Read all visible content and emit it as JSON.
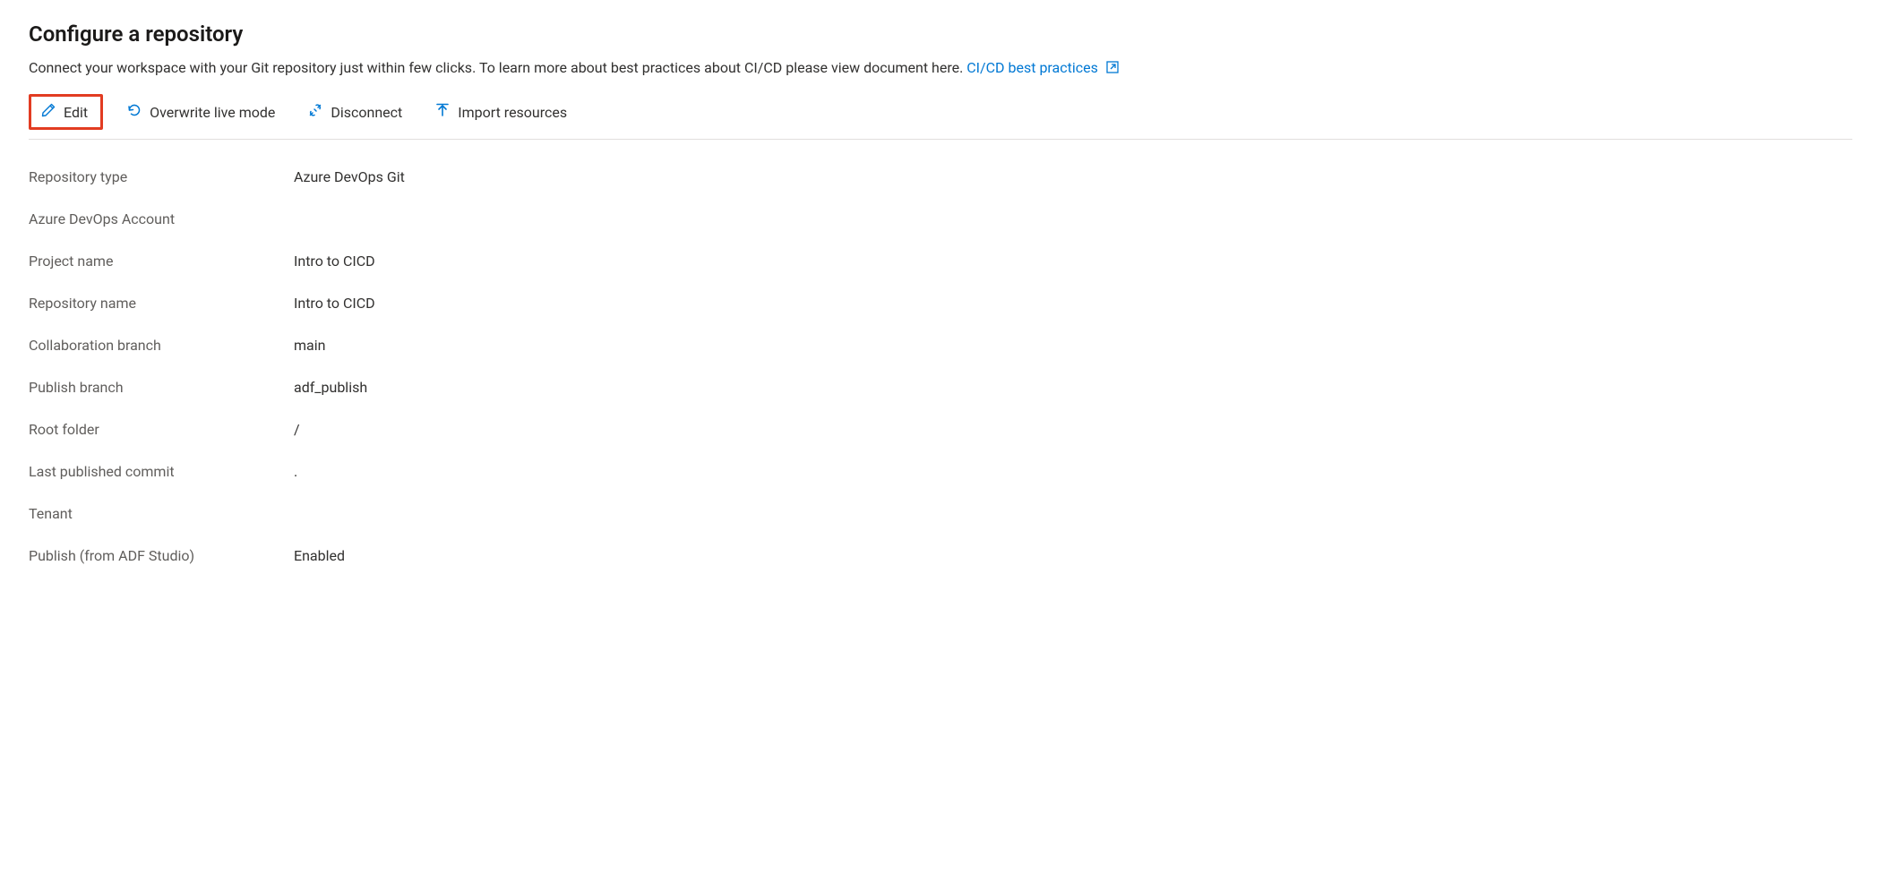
{
  "title": "Configure a repository",
  "description_text": "Connect your workspace with your Git repository just within few clicks. To learn more about best practices about CI/CD please view document here. ",
  "description_link": "CI/CD best practices",
  "toolbar": {
    "edit": "Edit",
    "overwrite": "Overwrite live mode",
    "disconnect": "Disconnect",
    "import": "Import resources"
  },
  "details": [
    {
      "label": "Repository type",
      "value": "Azure DevOps Git"
    },
    {
      "label": "Azure DevOps Account",
      "value": ""
    },
    {
      "label": "Project name",
      "value": "Intro to CICD"
    },
    {
      "label": "Repository name",
      "value": "Intro to CICD"
    },
    {
      "label": "Collaboration branch",
      "value": "main"
    },
    {
      "label": "Publish branch",
      "value": "adf_publish"
    },
    {
      "label": "Root folder",
      "value": "/"
    },
    {
      "label": "Last published commit",
      "value": "."
    },
    {
      "label": "Tenant",
      "value": ""
    },
    {
      "label": "Publish (from ADF Studio)",
      "value": "Enabled"
    }
  ]
}
